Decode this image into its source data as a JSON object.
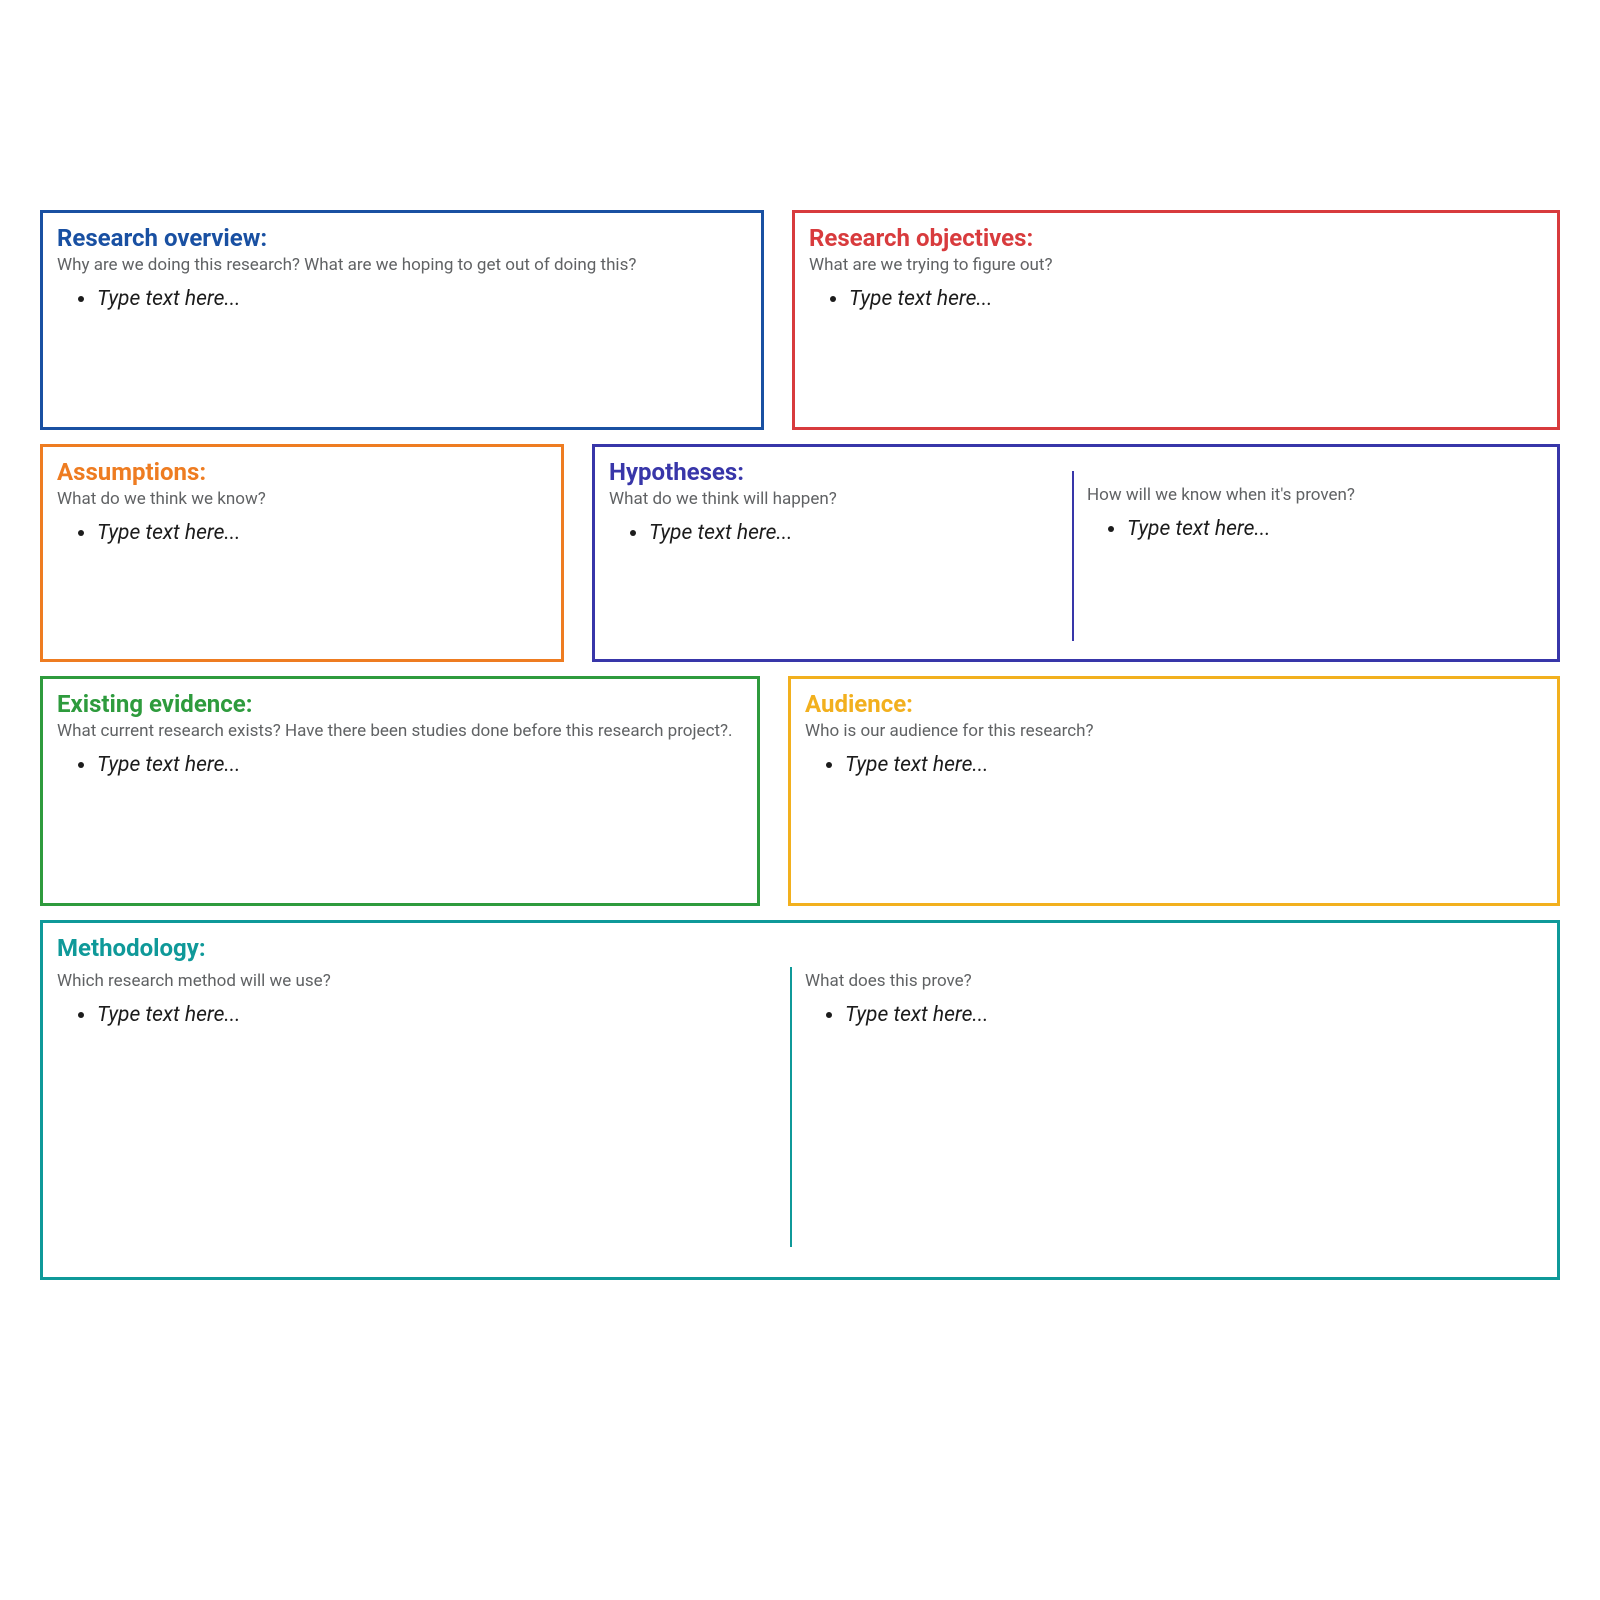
{
  "placeholder": "Type text here...",
  "cards": {
    "overview": {
      "title": "Research overview:",
      "subtitle": "Why are we doing this research? What are we hoping to get out of doing this?"
    },
    "objectives": {
      "title": "Research objectives:",
      "subtitle": "What are we trying to figure out?"
    },
    "assumptions": {
      "title": "Assumptions:",
      "subtitle": "What do we think we know?"
    },
    "hypotheses": {
      "title": "Hypotheses:",
      "subtitle_left": "What do we think will happen?",
      "subtitle_right": "How will we know when it's proven?"
    },
    "evidence": {
      "title": "Existing evidence:",
      "subtitle": "What current research exists? Have there been studies done before this research project?."
    },
    "audience": {
      "title": "Audience:",
      "subtitle": "Who is our audience for this research?"
    },
    "methodology": {
      "title": "Methodology:",
      "subtitle_left": "Which research method will we use?",
      "subtitle_right": "What does this prove?"
    }
  },
  "colors": {
    "blue": "#1950a2",
    "red": "#d83b3d",
    "orange": "#ee7c21",
    "indigo": "#3836a9",
    "green": "#2e9b3d",
    "amber": "#f2b01e",
    "teal": "#0f9999"
  }
}
